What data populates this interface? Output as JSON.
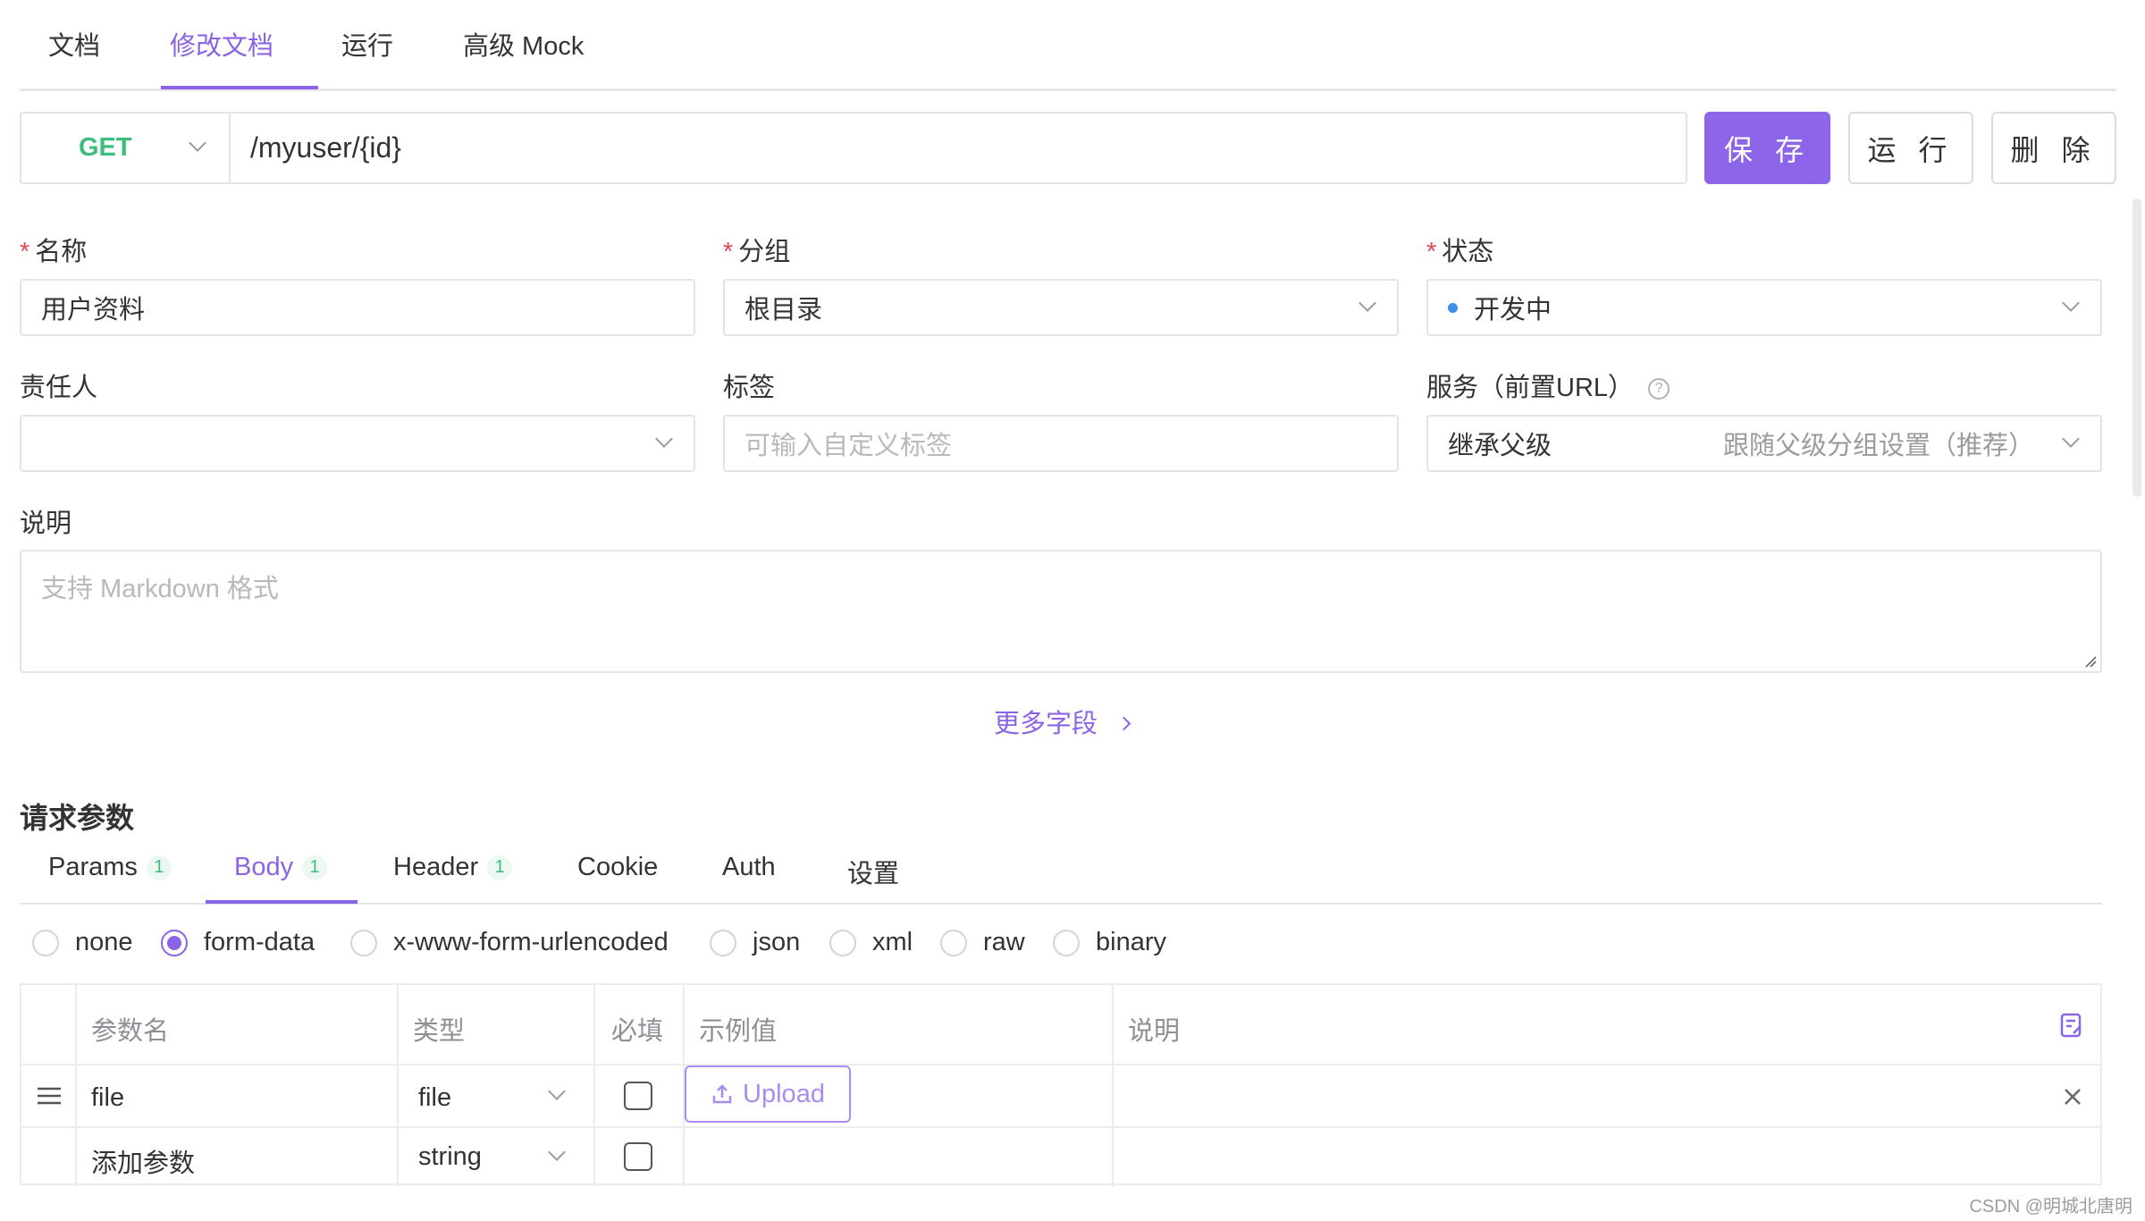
{
  "tabs": [
    "文档",
    "修改文档",
    "运行",
    "高级 Mock"
  ],
  "active_tab": "修改文档",
  "request": {
    "method": "GET",
    "url": "/myuser/{id}"
  },
  "actions": {
    "save": "保 存",
    "run": "运 行",
    "delete": "删 除"
  },
  "form": {
    "name_label": "名称",
    "name_value": "用户资料",
    "group_label": "分组",
    "group_value": "根目录",
    "status_label": "状态",
    "status_value": "开发中",
    "owner_label": "责任人",
    "owner_value": "",
    "tags_label": "标签",
    "tags_placeholder": "可输入自定义标签",
    "service_label": "服务（前置URL）",
    "service_value": "继承父级",
    "service_hint": "跟随父级分组设置（推荐）",
    "desc_label": "说明",
    "desc_placeholder": "支持 Markdown 格式",
    "required_mark": "*"
  },
  "more_fields": "更多字段",
  "params_section": {
    "title": "请求参数",
    "tabs": [
      {
        "label": "Params",
        "badge": "1"
      },
      {
        "label": "Body",
        "badge": "1"
      },
      {
        "label": "Header",
        "badge": "1"
      },
      {
        "label": "Cookie",
        "badge": ""
      },
      {
        "label": "Auth",
        "badge": ""
      },
      {
        "label": "设置",
        "badge": ""
      }
    ],
    "active_tab": "Body",
    "body_types": [
      "none",
      "form-data",
      "x-www-form-urlencoded",
      "json",
      "xml",
      "raw",
      "binary"
    ],
    "selected_body_type": "form-data"
  },
  "table": {
    "headers": [
      "参数名",
      "类型",
      "必填",
      "示例值",
      "说明"
    ],
    "rows": [
      {
        "name": "file",
        "type": "file",
        "required": false,
        "example_button": "Upload",
        "description": ""
      }
    ],
    "new_row": {
      "name_placeholder": "添加参数",
      "type": "string"
    }
  },
  "watermark": "CSDN @明城北唐明",
  "colors": {
    "accent": "#8a63e6",
    "method_get": "#3dbd7d",
    "required": "#e5484d",
    "status_dot": "#3d8fe8"
  }
}
